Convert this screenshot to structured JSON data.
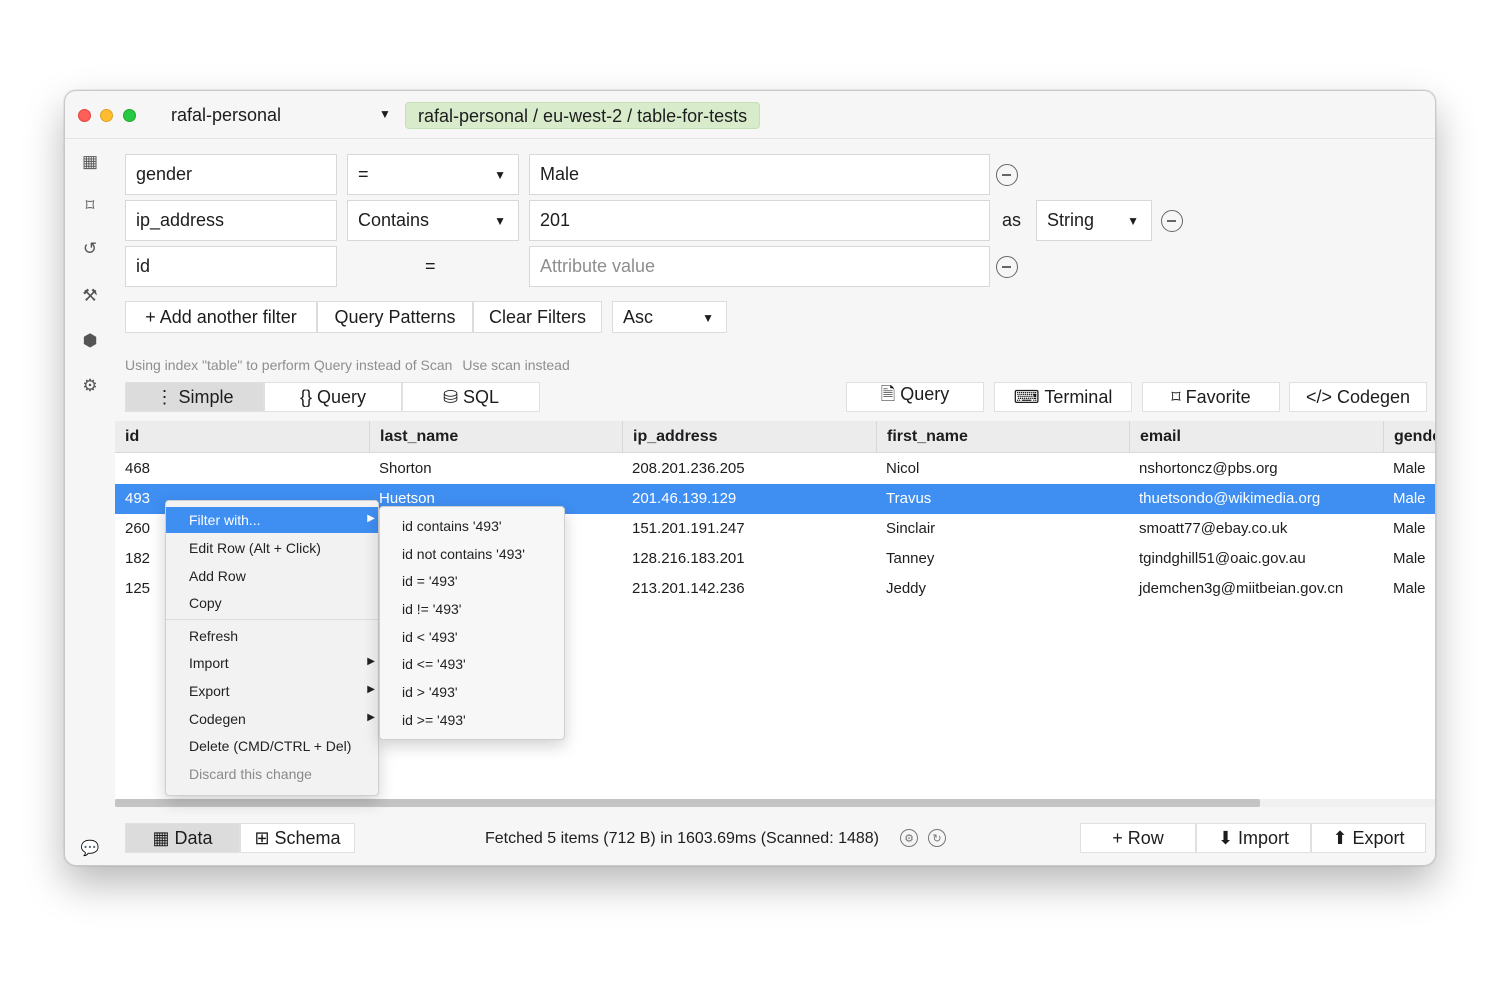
{
  "window": {
    "profile": "rafal-personal",
    "breadcrumb": "rafal-personal / eu-west-2 / table-for-tests"
  },
  "sidebar": {
    "items": [
      {
        "icon": "table-icon",
        "glyph": "▦"
      },
      {
        "icon": "bookmark-icon",
        "glyph": "⌑"
      },
      {
        "icon": "history-icon",
        "glyph": "↺"
      },
      {
        "icon": "hammer-icon",
        "glyph": "⚒"
      },
      {
        "icon": "box-icon",
        "glyph": "⬢"
      },
      {
        "icon": "gear-icon",
        "glyph": "⚙"
      }
    ],
    "chat_glyph": "💬"
  },
  "filters": [
    {
      "attribute": "gender",
      "operator": "=",
      "value": "Male",
      "value_placeholder": ""
    },
    {
      "attribute": "ip_address",
      "operator": "Contains",
      "value": "201",
      "as_label": "as",
      "type": "String"
    },
    {
      "attribute": "id",
      "operator": "=",
      "value": "",
      "value_placeholder": "Attribute value"
    }
  ],
  "actions": {
    "add_filter": "+ Add another filter",
    "query_patterns": "Query Patterns",
    "clear_filters": "Clear Filters",
    "sort": "Asc"
  },
  "hint": {
    "text": "Using index \"table\" to perform Query instead of Scan",
    "link": "Use scan instead"
  },
  "mode_tabs": {
    "simple": "⋮ Simple",
    "query": "{} Query",
    "sql": "⛁ SQL"
  },
  "right_tabs": {
    "query": "🗎 Query",
    "terminal": "⌨ Terminal",
    "favorite": "⌑ Favorite",
    "codegen": "</> Codegen"
  },
  "table": {
    "columns": [
      "id",
      "last_name",
      "ip_address",
      "first_name",
      "email",
      "gender"
    ],
    "rows": [
      [
        "468",
        "Shorton",
        "208.201.236.205",
        "Nicol",
        "nshortoncz@pbs.org",
        "Male"
      ],
      [
        "493",
        "Huetson",
        "201.46.139.129",
        "Travus",
        "thuetsondo@wikimedia.org",
        "Male"
      ],
      [
        "260",
        "",
        "151.201.191.247",
        "Sinclair",
        "smoatt77@ebay.co.uk",
        "Male"
      ],
      [
        "182",
        "",
        "128.216.183.201",
        "Tanney",
        "tgindghill51@oaic.gov.au",
        "Male"
      ],
      [
        "125",
        "",
        "213.201.142.236",
        "Jeddy",
        "jdemchen3g@miitbeian.gov.cn",
        "Male"
      ]
    ],
    "selected_row_index": 1
  },
  "context_menu": {
    "items": [
      {
        "label": "Filter with...",
        "submenu": true,
        "active": true
      },
      {
        "label": "Edit Row (Alt + Click)"
      },
      {
        "label": "Add Row"
      },
      {
        "label": "Copy"
      },
      {
        "label": "Refresh"
      },
      {
        "label": "Import",
        "submenu": true
      },
      {
        "label": "Export",
        "submenu": true
      },
      {
        "label": "Codegen",
        "submenu": true
      },
      {
        "label": "Delete (CMD/CTRL + Del)"
      },
      {
        "label": "Discard this change",
        "disabled": true
      }
    ],
    "submenu": [
      "id contains '493'",
      "id not contains '493'",
      "id = '493'",
      "id != '493'",
      "id < '493'",
      "id <= '493'",
      "id > '493'",
      "id >= '493'"
    ]
  },
  "bottom": {
    "data_tab": "▦ Data",
    "schema_tab": "⊞ Schema",
    "status": "Fetched 5 items (712 B) in 1603.69ms (Scanned: 1488)",
    "row_button": "+ Row",
    "import_button": "⬇ Import",
    "export_button": "⬆ Export"
  },
  "colors": {
    "selection": "#3f8ef2",
    "breadcrumb_bg": "#d8eccb"
  }
}
